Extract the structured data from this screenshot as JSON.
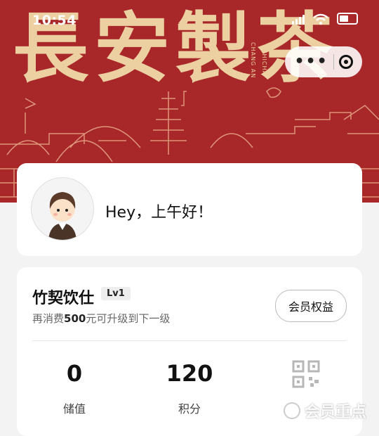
{
  "status_bar": {
    "time": "10:54"
  },
  "banner": {
    "brand_text": "長安製茶",
    "brand_subtitle_1": "CHANG AN",
    "brand_subtitle_2": "ZHICHA",
    "colors": {
      "background": "#a8282a",
      "gold": "#ecd0a2"
    }
  },
  "capsule": {
    "more_icon": "more-dots-icon",
    "close_icon": "target-icon"
  },
  "greeting": {
    "text": "Hey，上午好！"
  },
  "member": {
    "level_name": "竹契饮仕",
    "level_badge": "Lv1",
    "upgrade_prefix": "再消费",
    "upgrade_amount": "500",
    "upgrade_suffix": "元可升级到下一级",
    "benefits_button": "会员权益",
    "stats": [
      {
        "value": "0",
        "label": "储值"
      },
      {
        "value": "120",
        "label": "积分"
      }
    ],
    "qr_icon": "qr-code-icon"
  },
  "watermark": {
    "text": "会员重点"
  }
}
